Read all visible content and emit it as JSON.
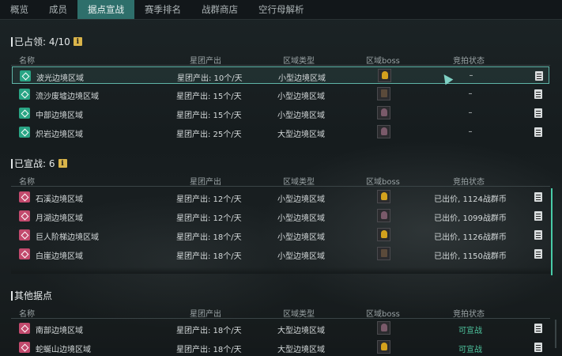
{
  "tabs": [
    "概览",
    "成员",
    "据点宣战",
    "赛季排名",
    "战群商店",
    "空行母解析"
  ],
  "active_tab": 2,
  "columns": {
    "name": "名称",
    "output": "星团产出",
    "type": "区域类型",
    "boss": "区域boss",
    "status": "竞拍状态"
  },
  "occupied": {
    "title": "已占领: 4/10",
    "rows": [
      {
        "name": "波光边境区域",
        "output": "星团产出: 10个/天",
        "type": "小型边境区域",
        "status": "–",
        "boss": "gold"
      },
      {
        "name": "流沙废墟边境区域",
        "output": "星团产出: 15个/天",
        "type": "小型边境区域",
        "status": "–",
        "boss": "mech"
      },
      {
        "name": "中部边境区域",
        "output": "星团产出: 15个/天",
        "type": "小型边境区域",
        "status": "–",
        "boss": "pink"
      },
      {
        "name": "炽岩边境区域",
        "output": "星团产出: 25个/天",
        "type": "大型边境区域",
        "status": "–",
        "boss": "pink"
      }
    ]
  },
  "declared": {
    "title": "已宣战: 6",
    "rows": [
      {
        "name": "石溪边境区域",
        "output": "星团产出: 12个/天",
        "type": "小型边境区域",
        "status": "已出价, 1124战群币",
        "boss": "gold"
      },
      {
        "name": "月湖边境区域",
        "output": "星团产出: 12个/天",
        "type": "小型边境区域",
        "status": "已出价, 1099战群币",
        "boss": "pink"
      },
      {
        "name": "巨人阶梯边境区域",
        "output": "星团产出: 18个/天",
        "type": "小型边境区域",
        "status": "已出价, 1126战群币",
        "boss": "gold"
      },
      {
        "name": "白崖边境区域",
        "output": "星团产出: 18个/天",
        "type": "小型边境区域",
        "status": "已出价, 1150战群币",
        "boss": "mech"
      }
    ]
  },
  "others": {
    "title": "其他据点",
    "rows": [
      {
        "name": "南部边境区域",
        "output": "星团产出: 18个/天",
        "type": "大型边境区域",
        "status": "可宣战",
        "boss": "pink"
      },
      {
        "name": "蛇蜒山边境区域",
        "output": "星团产出: 18个/天",
        "type": "大型边境区域",
        "status": "可宣战",
        "boss": "gold"
      }
    ]
  },
  "colors": {
    "accent": "#2e6f6b",
    "occupied_icon": "#2aa585",
    "declared_icon": "#c24a6d",
    "can_declare": "#4fc7a0"
  }
}
